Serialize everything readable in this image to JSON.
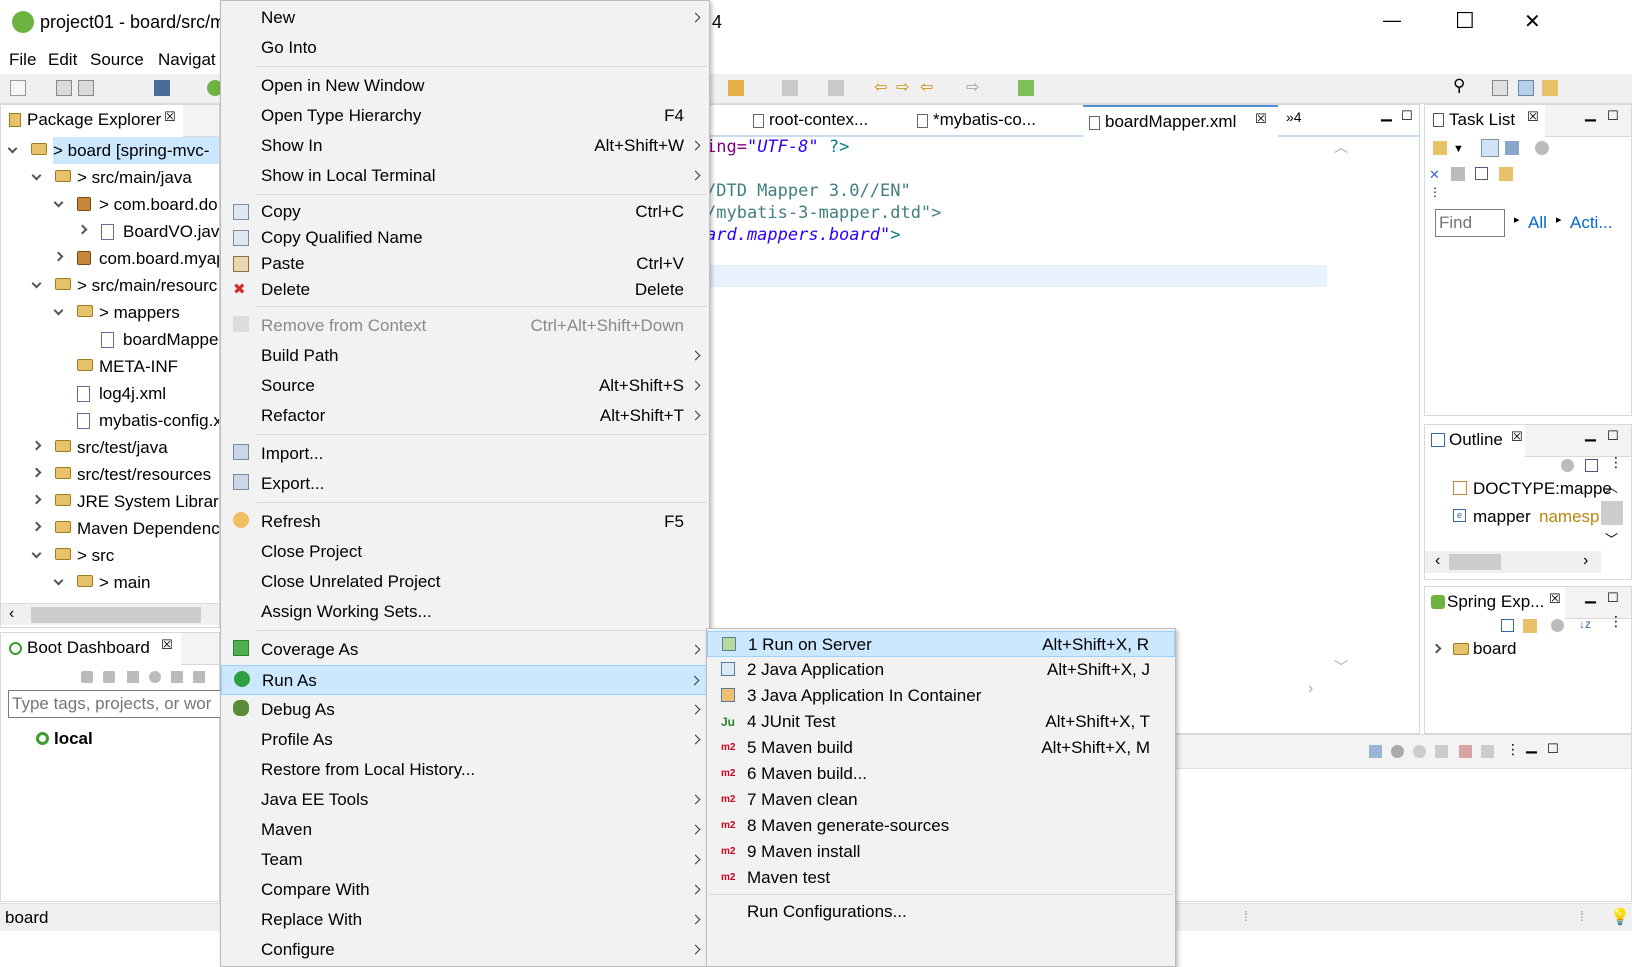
{
  "window": {
    "title": "project01 - board/src/m",
    "title_suffix": "4",
    "controls": {
      "minimize": "—",
      "maximize": "☐",
      "close": "✕"
    }
  },
  "menubar": [
    "File",
    "Edit",
    "Source",
    "Navigat"
  ],
  "package_explorer": {
    "title": "Package Explorer",
    "tree": [
      {
        "label": "> board [spring-mvc-",
        "level": 0,
        "state": "open",
        "icon": "project-icon"
      },
      {
        "label": "> src/main/java",
        "level": 1,
        "state": "open",
        "icon": "source-folder-icon"
      },
      {
        "label": "> com.board.do",
        "level": 2,
        "state": "open",
        "icon": "package-icon"
      },
      {
        "label": "BoardVO.java",
        "level": 3,
        "state": "closed",
        "icon": "java-file-icon"
      },
      {
        "label": "com.board.myap",
        "level": 2,
        "state": "closed",
        "icon": "package-icon"
      },
      {
        "label": "> src/main/resourc",
        "level": 1,
        "state": "open",
        "icon": "source-folder-icon"
      },
      {
        "label": "> mappers",
        "level": 2,
        "state": "open",
        "icon": "folder-icon"
      },
      {
        "label": "boardMappe",
        "level": 3,
        "state": "none",
        "icon": "xml-file-icon"
      },
      {
        "label": "META-INF",
        "level": 2,
        "state": "none",
        "icon": "folder-icon"
      },
      {
        "label": "log4j.xml",
        "level": 2,
        "state": "none",
        "icon": "xml-file-icon"
      },
      {
        "label": "mybatis-config.x",
        "level": 2,
        "state": "none",
        "icon": "xml-file-icon"
      },
      {
        "label": "src/test/java",
        "level": 1,
        "state": "closed",
        "icon": "source-folder-icon"
      },
      {
        "label": "src/test/resources",
        "level": 1,
        "state": "closed",
        "icon": "source-folder-icon"
      },
      {
        "label": "JRE System Library",
        "level": 1,
        "state": "closed",
        "icon": "library-icon"
      },
      {
        "label": "Maven Dependenc",
        "level": 1,
        "state": "closed",
        "icon": "library-icon"
      },
      {
        "label": "> src",
        "level": 1,
        "state": "open",
        "icon": "folder-icon"
      },
      {
        "label": "> main",
        "level": 2,
        "state": "open",
        "icon": "folder-icon"
      }
    ]
  },
  "boot_dashboard": {
    "title": "Boot Dashboard",
    "filter_placeholder": "Type tags, projects, or wor",
    "local_label": "local"
  },
  "status_bar": {
    "text": "board"
  },
  "editor": {
    "tabs": [
      {
        "label": "root-contex...",
        "active": false
      },
      {
        "label": "*mybatis-co...",
        "active": false
      },
      {
        "label": "boardMapper.xml",
        "active": true
      },
      {
        "label": "»4",
        "active": false
      }
    ],
    "lines": [
      {
        "parts": [
          {
            "t": "ing=",
            "c": "#7f007f"
          },
          {
            "t": "\"UTF-8\"",
            "c": "#2a00ff",
            "i": true
          },
          {
            "t": " ?>",
            "c": "#008080"
          }
        ]
      },
      {
        "parts": [
          {
            "t": "",
            "c": "#000"
          }
        ]
      },
      {
        "parts": [
          {
            "t": "/DTD Mapper 3.0//EN\"",
            "c": "#3f7f7f"
          }
        ]
      },
      {
        "parts": [
          {
            "t": "/mybatis-3-mapper.dtd\">",
            "c": "#3f7f7f"
          }
        ]
      },
      {
        "parts": [
          {
            "t": "ard.mappers.board\"",
            "c": "#2a00ff",
            "i": true
          },
          {
            "t": ">",
            "c": "#008080"
          }
        ]
      }
    ]
  },
  "task_list": {
    "title": "Task List",
    "find_placeholder": "Find",
    "all_label": "All",
    "activate_label": "Acti..."
  },
  "outline": {
    "title": "Outline",
    "items": [
      {
        "label": "DOCTYPE:mappe",
        "extra": ""
      },
      {
        "label": "mapper",
        "extra": "namesp"
      }
    ]
  },
  "spring_explorer": {
    "title": "Spring Exp...",
    "items": [
      "board"
    ]
  },
  "context_menu": {
    "items": [
      {
        "label": "New",
        "shortcut": "",
        "sub": true,
        "icon": ""
      },
      {
        "label": "Go Into",
        "shortcut": "",
        "sub": false,
        "icon": ""
      },
      {
        "sep": true
      },
      {
        "label": "Open in New Window",
        "shortcut": "",
        "sub": false,
        "icon": ""
      },
      {
        "label": "Open Type Hierarchy",
        "shortcut": "F4",
        "sub": false,
        "icon": ""
      },
      {
        "label": "Show In",
        "shortcut": "Alt+Shift+W",
        "sub": true,
        "icon": ""
      },
      {
        "label": "Show in Local Terminal",
        "shortcut": "",
        "sub": true,
        "icon": ""
      },
      {
        "sep": true
      },
      {
        "label": "Copy",
        "shortcut": "Ctrl+C",
        "sub": false,
        "icon": "copy-icon"
      },
      {
        "label": "Copy Qualified Name",
        "shortcut": "",
        "sub": false,
        "icon": "copy-icon"
      },
      {
        "label": "Paste",
        "shortcut": "Ctrl+V",
        "sub": false,
        "icon": "paste-icon"
      },
      {
        "label": "Delete",
        "shortcut": "Delete",
        "sub": false,
        "icon": "delete-icon"
      },
      {
        "sep": true
      },
      {
        "label": "Remove from Context",
        "shortcut": "Ctrl+Alt+Shift+Down",
        "sub": false,
        "icon": "remove-icon",
        "disabled": true
      },
      {
        "label": "Build Path",
        "shortcut": "",
        "sub": true,
        "icon": ""
      },
      {
        "label": "Source",
        "shortcut": "Alt+Shift+S",
        "sub": true,
        "icon": ""
      },
      {
        "label": "Refactor",
        "shortcut": "Alt+Shift+T",
        "sub": true,
        "icon": ""
      },
      {
        "sep": true
      },
      {
        "label": "Import...",
        "shortcut": "",
        "sub": false,
        "icon": "import-icon"
      },
      {
        "label": "Export...",
        "shortcut": "",
        "sub": false,
        "icon": "export-icon"
      },
      {
        "sep": true
      },
      {
        "label": "Refresh",
        "shortcut": "F5",
        "sub": false,
        "icon": "refresh-icon"
      },
      {
        "label": "Close Project",
        "shortcut": "",
        "sub": false,
        "icon": ""
      },
      {
        "label": "Close Unrelated Project",
        "shortcut": "",
        "sub": false,
        "icon": ""
      },
      {
        "label": "Assign Working Sets...",
        "shortcut": "",
        "sub": false,
        "icon": ""
      },
      {
        "sep": true
      },
      {
        "label": "Coverage As",
        "shortcut": "",
        "sub": true,
        "icon": "coverage-icon"
      },
      {
        "label": "Run As",
        "shortcut": "",
        "sub": true,
        "icon": "run-icon",
        "highlight": true
      },
      {
        "label": "Debug As",
        "shortcut": "",
        "sub": true,
        "icon": "debug-icon"
      },
      {
        "label": "Profile As",
        "shortcut": "",
        "sub": true,
        "icon": ""
      },
      {
        "label": "Restore from Local History...",
        "shortcut": "",
        "sub": false,
        "icon": ""
      },
      {
        "label": "Java EE Tools",
        "shortcut": "",
        "sub": true,
        "icon": ""
      },
      {
        "label": "Maven",
        "shortcut": "",
        "sub": true,
        "icon": ""
      },
      {
        "label": "Team",
        "shortcut": "",
        "sub": true,
        "icon": ""
      },
      {
        "label": "Compare With",
        "shortcut": "",
        "sub": true,
        "icon": ""
      },
      {
        "label": "Replace With",
        "shortcut": "",
        "sub": true,
        "icon": ""
      },
      {
        "label": "Configure",
        "shortcut": "",
        "sub": true,
        "icon": ""
      }
    ]
  },
  "run_as_menu": {
    "items": [
      {
        "label": "1 Run on Server",
        "shortcut": "Alt+Shift+X, R",
        "icon": "server-icon",
        "highlight": true
      },
      {
        "label": "2 Java Application",
        "shortcut": "Alt+Shift+X, J",
        "icon": "java-app-icon"
      },
      {
        "label": "3 Java Application In Container",
        "shortcut": "",
        "icon": "container-icon"
      },
      {
        "label": "4 JUnit Test",
        "shortcut": "Alt+Shift+X, T",
        "icon": "junit-icon"
      },
      {
        "label": "5 Maven build",
        "shortcut": "Alt+Shift+X, M",
        "icon": "maven-icon"
      },
      {
        "label": "6 Maven build...",
        "shortcut": "",
        "icon": "maven-icon"
      },
      {
        "label": "7 Maven clean",
        "shortcut": "",
        "icon": "maven-icon"
      },
      {
        "label": "8 Maven generate-sources",
        "shortcut": "",
        "icon": "maven-icon"
      },
      {
        "label": "9 Maven install",
        "shortcut": "",
        "icon": "maven-icon"
      },
      {
        "label": "Maven test",
        "shortcut": "",
        "icon": "maven-icon"
      },
      {
        "sep": true
      },
      {
        "label": "Run Configurations...",
        "shortcut": "",
        "icon": ""
      }
    ]
  },
  "icon_text": {
    "junit": "Ju",
    "maven": "m2"
  },
  "colors": {
    "menu_bg": "#f2f2f2",
    "highlight": "#cce8ff",
    "editor_line": "#e8f2fe"
  }
}
